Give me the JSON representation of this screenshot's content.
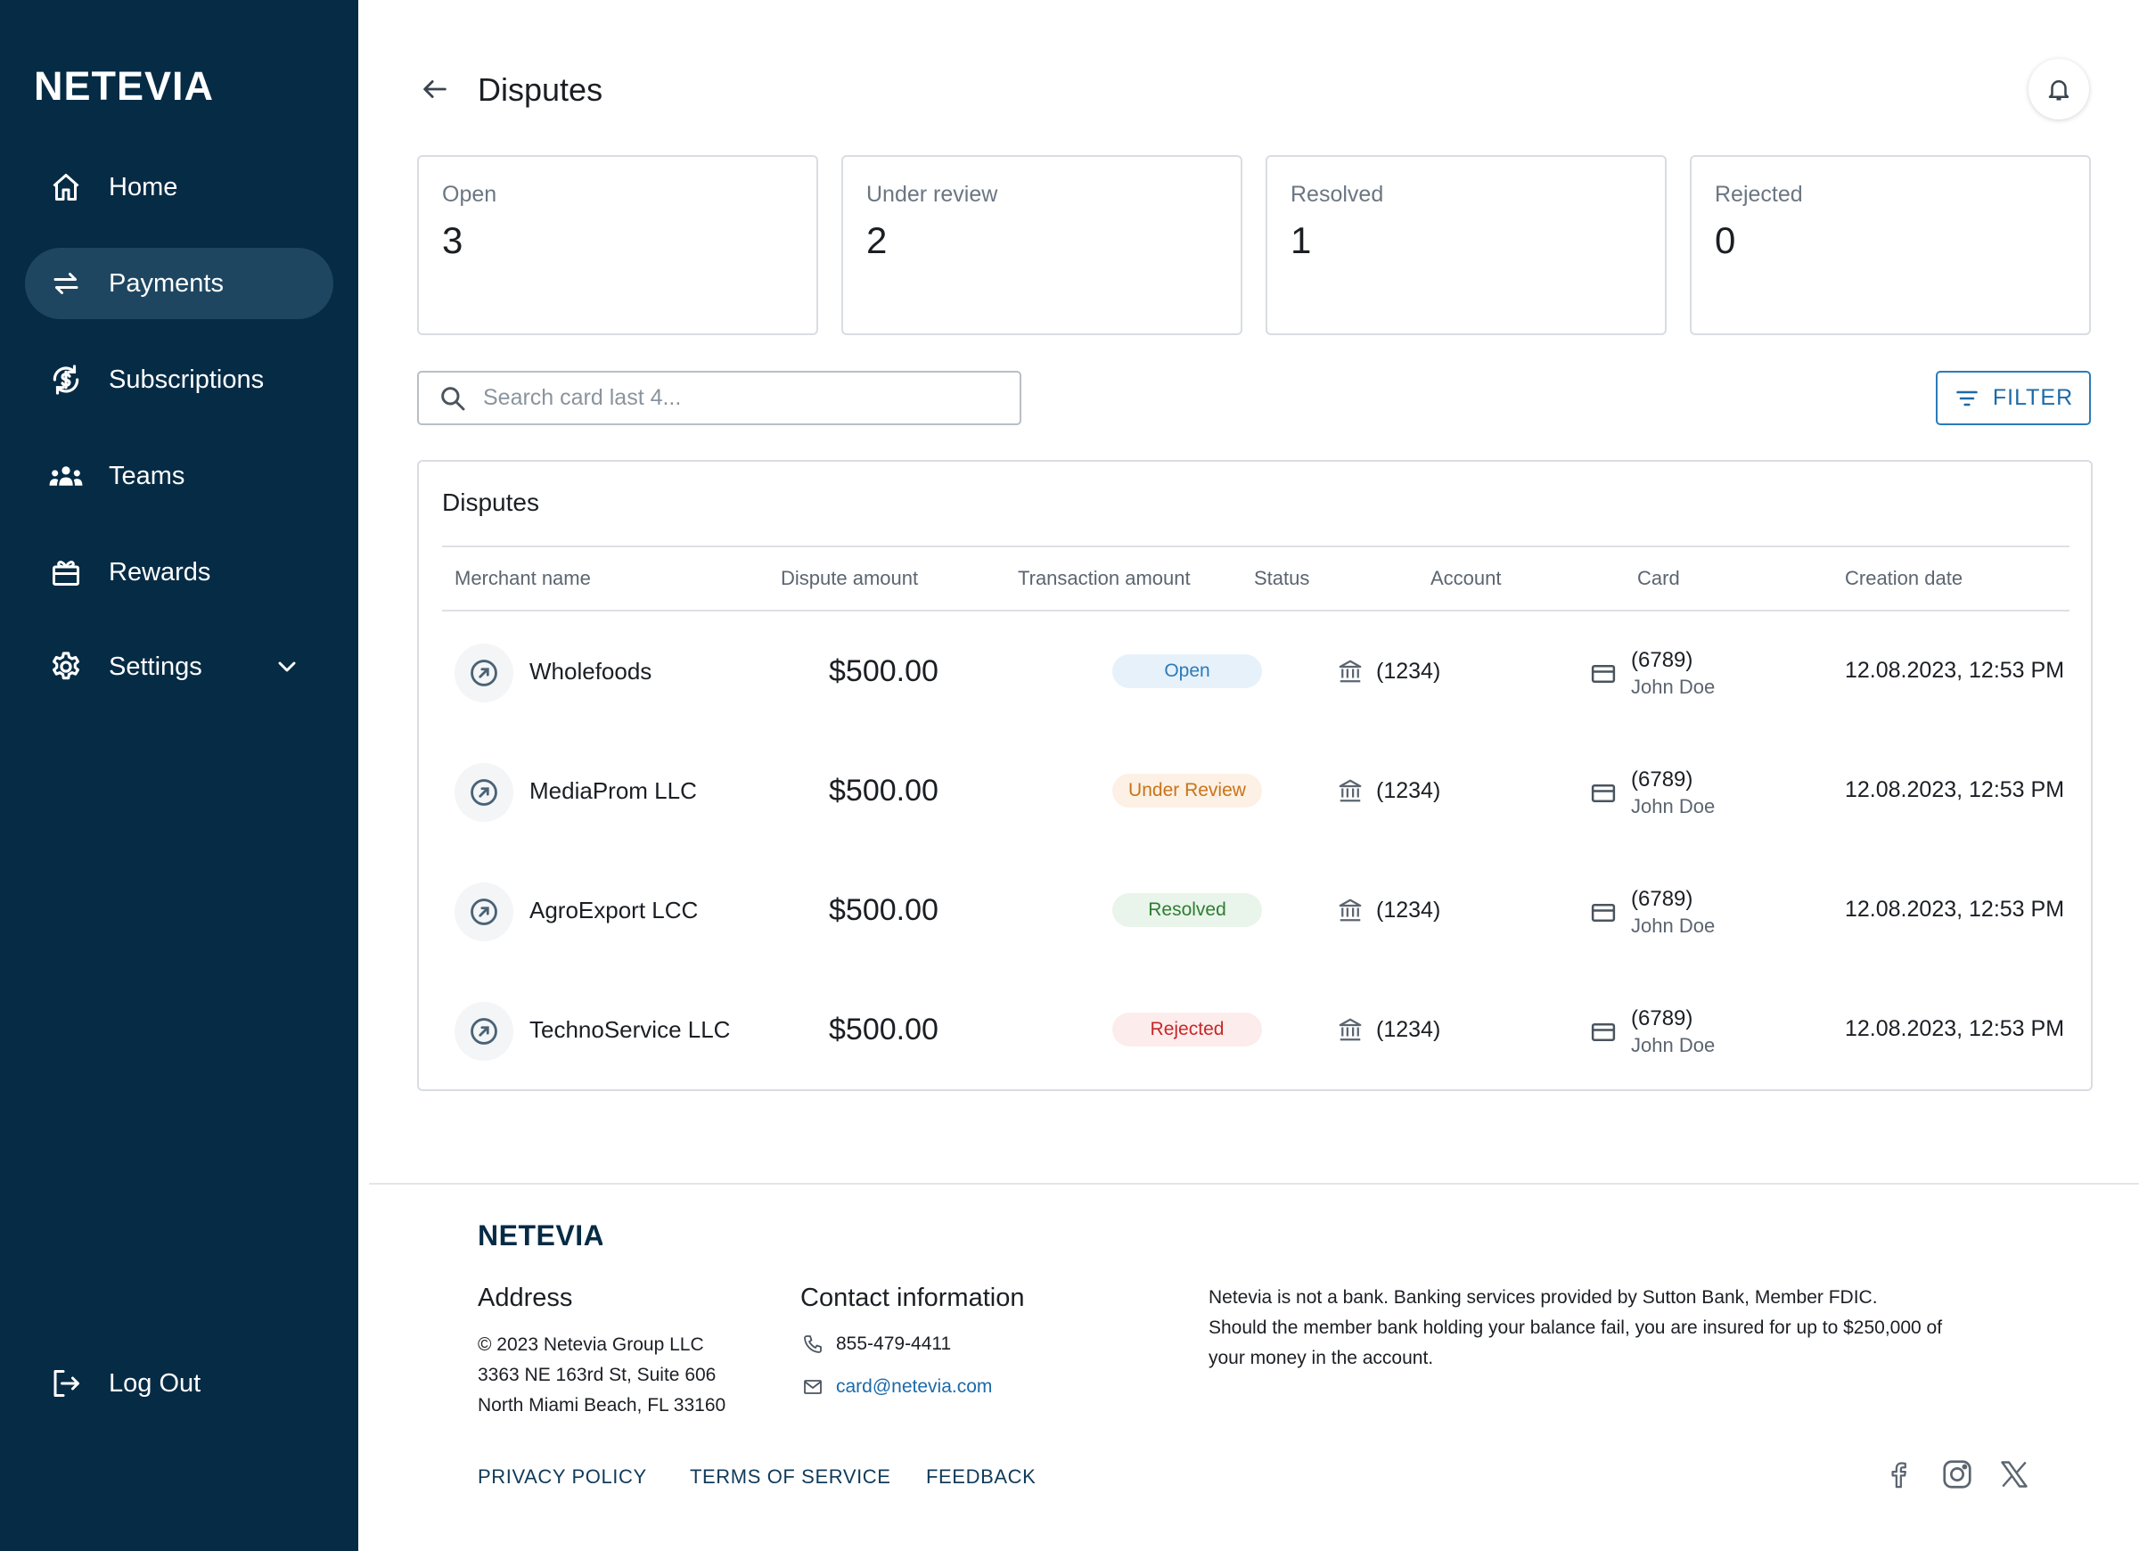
{
  "brand": {
    "name": "NETEVIA"
  },
  "sidebar": {
    "items": [
      {
        "label": "Home",
        "icon": "home-icon"
      },
      {
        "label": "Payments",
        "icon": "transfer-arrows-icon",
        "active": true
      },
      {
        "label": "Subscriptions",
        "icon": "recurring-dollar-icon"
      },
      {
        "label": "Teams",
        "icon": "team-icon"
      },
      {
        "label": "Rewards",
        "icon": "gift-icon"
      },
      {
        "label": "Settings",
        "icon": "gear-icon"
      }
    ],
    "logout": "Log Out"
  },
  "header": {
    "title": "Disputes"
  },
  "stats": [
    {
      "label": "Open",
      "value": "3"
    },
    {
      "label": "Under review",
      "value": "2"
    },
    {
      "label": "Resolved",
      "value": "1"
    },
    {
      "label": "Rejected",
      "value": "0"
    }
  ],
  "search": {
    "placeholder": "Search card last 4..."
  },
  "filter": {
    "label": "FILTER"
  },
  "table": {
    "title": "Disputes",
    "columns": [
      "Merchant name",
      "Dispute amount",
      "Transaction amount",
      "Status",
      "Account",
      "Card",
      "Creation date"
    ],
    "rows": [
      {
        "merchant": "Wholefoods",
        "amount": "$500.00",
        "status": "Open",
        "account": "(1234)",
        "card": "(6789)",
        "holder": "John Doe",
        "date": "12.08.2023, 12:53 PM"
      },
      {
        "merchant": "MediaProm LLC",
        "amount": "$500.00",
        "status": "Under Review",
        "account": "(1234)",
        "card": "(6789)",
        "holder": "John Doe",
        "date": "12.08.2023, 12:53 PM"
      },
      {
        "merchant": "AgroExport LCC",
        "amount": "$500.00",
        "status": "Resolved",
        "account": "(1234)",
        "card": "(6789)",
        "holder": "John Doe",
        "date": "12.08.2023, 12:53 PM"
      },
      {
        "merchant": "TechnoService LLC",
        "amount": "$500.00",
        "status": "Rejected",
        "account": "(1234)",
        "card": "(6789)",
        "holder": "John Doe",
        "date": "12.08.2023, 12:53 PM"
      }
    ]
  },
  "status_colors": {
    "Open": {
      "bg": "#e7f1fa",
      "fg": "#2b7bb9"
    },
    "Under Review": {
      "bg": "#fdf0e4",
      "fg": "#c8741a"
    },
    "Resolved": {
      "bg": "#e9f4ea",
      "fg": "#2e7d32"
    },
    "Rejected": {
      "bg": "#fdecec",
      "fg": "#c62828"
    }
  },
  "footer": {
    "address_title": "Address",
    "address_lines": [
      "© 2023 Netevia Group LLC",
      "3363 NE 163rd St, Suite 606",
      "North Miami Beach, FL 33160"
    ],
    "contact_title": "Contact information",
    "phone": "855-479-4411",
    "email": "card@netevia.com",
    "disclaimer_lines": [
      "Netevia is not a bank. Banking services provided by Sutton Bank, Member FDIC.",
      "Should the member bank holding your balance fail, you are insured for up to $250,000 of",
      "your money in the account."
    ],
    "links": [
      "PRIVACY POLICY",
      "TERMS OF SERVICE",
      "FEEDBACK"
    ],
    "social": [
      "facebook-icon",
      "instagram-icon",
      "x-icon"
    ]
  },
  "colors": {
    "sidebar": "#062b45",
    "accent": "#1c6aa8"
  }
}
